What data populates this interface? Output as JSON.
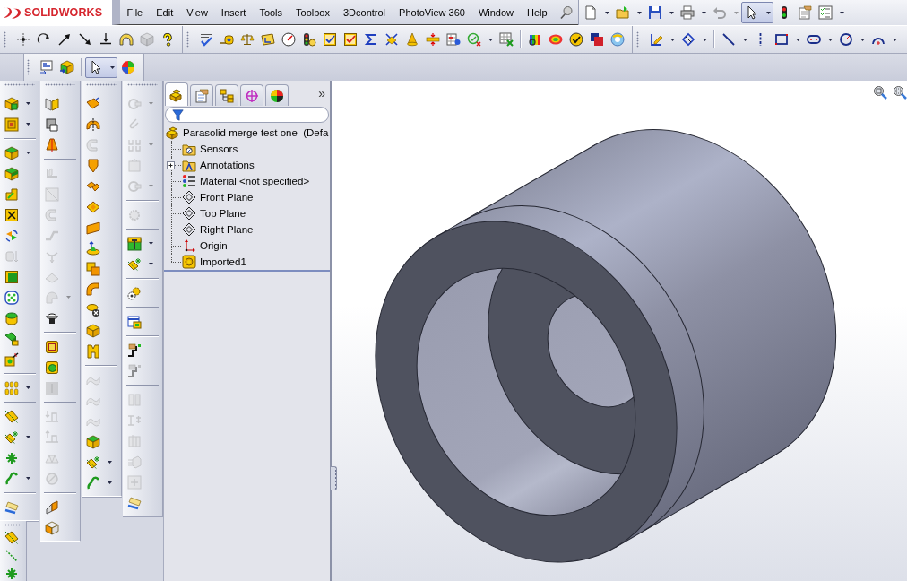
{
  "logo": {
    "text": "SOLIDWORKS"
  },
  "menu": [
    "File",
    "Edit",
    "View",
    "Insert",
    "Tools",
    "Toolbox",
    "3Dcontrol",
    "PhotoView 360",
    "Window",
    "Help"
  ],
  "standard_toolbar": {
    "buttons": [
      {
        "kind": "dropdown",
        "disabled": false,
        "pressed": false
      },
      {
        "kind": "dropdown",
        "disabled": false,
        "pressed": false
      },
      {
        "kind": "dropdown",
        "disabled": false,
        "pressed": false
      },
      {
        "kind": "dropdown",
        "disabled": false,
        "pressed": false
      },
      {
        "kind": "dropdown",
        "disabled": true,
        "pressed": false
      },
      {
        "kind": "dropdown",
        "disabled": false,
        "pressed": true
      },
      {
        "kind": "plain",
        "disabled": false,
        "pressed": false
      },
      {
        "kind": "plain",
        "disabled": false,
        "pressed": false
      },
      {
        "kind": "dropdown",
        "disabled": false,
        "pressed": false
      }
    ]
  },
  "toolbar_rows": [
    {
      "toolbars": [
        {
          "groups": [
            [
              {
                "kind": "plain",
                "disabled": false
              },
              {
                "kind": "plain",
                "disabled": false
              },
              {
                "kind": "plain",
                "disabled": false
              },
              {
                "kind": "plain",
                "disabled": false
              },
              {
                "kind": "plain",
                "disabled": false
              },
              {
                "kind": "plain",
                "disabled": false
              },
              {
                "kind": "plain",
                "disabled": true
              },
              {
                "kind": "plain",
                "disabled": false
              }
            ]
          ]
        },
        {
          "groups": [
            [
              {
                "kind": "plain",
                "disabled": false
              },
              {
                "kind": "plain",
                "disabled": false
              },
              {
                "kind": "plain",
                "disabled": false
              },
              {
                "kind": "plain",
                "disabled": false
              },
              {
                "kind": "plain",
                "disabled": false
              },
              {
                "kind": "plain",
                "disabled": false
              },
              {
                "kind": "plain",
                "disabled": false
              },
              {
                "kind": "plain",
                "disabled": false
              },
              {
                "kind": "plain",
                "disabled": false
              },
              {
                "kind": "plain",
                "disabled": false
              },
              {
                "kind": "plain",
                "disabled": false
              },
              {
                "kind": "plain",
                "disabled": false
              },
              {
                "kind": "plain",
                "disabled": false
              },
              {
                "kind": "dropdown",
                "disabled": false
              },
              {
                "kind": "plain",
                "disabled": false
              }
            ],
            [
              {
                "kind": "plain",
                "disabled": false
              },
              {
                "kind": "plain",
                "disabled": false
              },
              {
                "kind": "plain",
                "disabled": false
              },
              {
                "kind": "plain",
                "disabled": false
              },
              {
                "kind": "plain",
                "disabled": false
              }
            ]
          ]
        },
        {
          "groups": [
            [
              {
                "kind": "dropdown",
                "disabled": false
              },
              {
                "kind": "dropdown",
                "disabled": false
              }
            ],
            [
              {
                "kind": "dropdown",
                "disabled": false
              },
              {
                "kind": "plain",
                "disabled": false
              },
              {
                "kind": "dropdown",
                "disabled": false
              },
              {
                "kind": "dropdown",
                "disabled": false
              },
              {
                "kind": "dropdown",
                "disabled": false
              },
              {
                "kind": "dropdown",
                "disabled": false
              }
            ]
          ]
        }
      ]
    },
    {
      "toolbars": [
        {
          "groups": [
            [
              {
                "kind": "plain",
                "disabled": false,
                "pressed": false
              },
              {
                "kind": "plain",
                "disabled": false,
                "pressed": false
              }
            ],
            [
              {
                "kind": "dropdown",
                "disabled": false,
                "pressed": true
              },
              {
                "kind": "plain",
                "disabled": false,
                "pressed": false
              }
            ]
          ]
        }
      ]
    }
  ],
  "side_toolbars": [
    {
      "groups": [
        [
          {
            "kind": "dropdown",
            "disabled": false
          },
          {
            "kind": "dropdown",
            "disabled": false
          }
        ],
        [
          {
            "kind": "dropdown",
            "disabled": false
          },
          {
            "kind": "plain",
            "disabled": false
          },
          {
            "kind": "plain",
            "disabled": false
          },
          {
            "kind": "plain",
            "disabled": false
          },
          {
            "kind": "plain",
            "disabled": false
          },
          {
            "kind": "plain",
            "disabled": true
          },
          {
            "kind": "plain",
            "disabled": false
          },
          {
            "kind": "plain",
            "disabled": false
          },
          {
            "kind": "plain",
            "disabled": false
          },
          {
            "kind": "plain",
            "disabled": false
          },
          {
            "kind": "plain",
            "disabled": false
          }
        ],
        [
          {
            "kind": "dropdown",
            "disabled": false
          }
        ],
        [
          {
            "kind": "plain",
            "disabled": false
          },
          {
            "kind": "dropdown",
            "disabled": false
          },
          {
            "kind": "plain",
            "disabled": false
          },
          {
            "kind": "dropdown",
            "disabled": false
          }
        ],
        [
          {
            "kind": "plain",
            "disabled": false
          }
        ]
      ]
    },
    {
      "groups": [
        [
          {
            "kind": "plain",
            "disabled": false
          },
          {
            "kind": "plain",
            "disabled": false
          },
          {
            "kind": "plain",
            "disabled": false
          }
        ],
        [
          {
            "kind": "plain",
            "disabled": true
          },
          {
            "kind": "plain",
            "disabled": true
          },
          {
            "kind": "plain",
            "disabled": true
          },
          {
            "kind": "plain",
            "disabled": true
          },
          {
            "kind": "plain",
            "disabled": true
          },
          {
            "kind": "plain",
            "disabled": true
          },
          {
            "kind": "dropdown",
            "disabled": true
          },
          {
            "kind": "plain",
            "disabled": false
          }
        ],
        [
          {
            "kind": "plain",
            "disabled": false
          },
          {
            "kind": "plain",
            "disabled": false
          },
          {
            "kind": "plain",
            "disabled": true
          }
        ],
        [
          {
            "kind": "plain",
            "disabled": true
          },
          {
            "kind": "plain",
            "disabled": true
          },
          {
            "kind": "plain",
            "disabled": true
          },
          {
            "kind": "plain",
            "disabled": true
          }
        ],
        [
          {
            "kind": "plain",
            "disabled": false
          },
          {
            "kind": "plain",
            "disabled": false
          }
        ]
      ]
    },
    {
      "groups": [
        [
          {
            "kind": "plain",
            "disabled": false
          },
          {
            "kind": "plain",
            "disabled": false
          },
          {
            "kind": "plain",
            "disabled": true
          },
          {
            "kind": "plain",
            "disabled": false
          },
          {
            "kind": "plain",
            "disabled": false
          },
          {
            "kind": "plain",
            "disabled": false
          },
          {
            "kind": "plain",
            "disabled": false
          },
          {
            "kind": "plain",
            "disabled": false
          },
          {
            "kind": "plain",
            "disabled": false
          },
          {
            "kind": "plain",
            "disabled": false
          },
          {
            "kind": "plain",
            "disabled": false
          },
          {
            "kind": "plain",
            "disabled": false
          },
          {
            "kind": "plain",
            "disabled": false
          }
        ],
        [
          {
            "kind": "plain",
            "disabled": true
          },
          {
            "kind": "plain",
            "disabled": true
          },
          {
            "kind": "plain",
            "disabled": true
          },
          {
            "kind": "plain",
            "disabled": false
          },
          {
            "kind": "dropdown",
            "disabled": false
          },
          {
            "kind": "dropdown",
            "disabled": false
          }
        ]
      ]
    },
    {
      "groups": [
        [
          {
            "kind": "dropdown",
            "disabled": true
          },
          {
            "kind": "plain",
            "disabled": true
          },
          {
            "kind": "dropdown",
            "disabled": true
          },
          {
            "kind": "plain",
            "disabled": true
          },
          {
            "kind": "dropdown",
            "disabled": true
          }
        ],
        [
          {
            "kind": "plain",
            "disabled": true
          }
        ],
        [
          {
            "kind": "dropdown",
            "disabled": false
          },
          {
            "kind": "dropdown",
            "disabled": false
          }
        ],
        [
          {
            "kind": "plain",
            "disabled": false
          }
        ],
        [
          {
            "kind": "plain",
            "disabled": false
          }
        ],
        [
          {
            "kind": "plain",
            "disabled": false
          },
          {
            "kind": "plain",
            "disabled": true
          }
        ],
        [
          {
            "kind": "plain",
            "disabled": true
          },
          {
            "kind": "plain",
            "disabled": true
          },
          {
            "kind": "plain",
            "disabled": true
          },
          {
            "kind": "plain",
            "disabled": true
          },
          {
            "kind": "plain",
            "disabled": true
          },
          {
            "kind": "plain",
            "disabled": false
          }
        ]
      ]
    },
    {
      "groups": [
        [
          {
            "kind": "plain",
            "disabled": false
          },
          {
            "kind": "plain",
            "disabled": false
          },
          {
            "kind": "plain",
            "disabled": false
          }
        ]
      ]
    }
  ],
  "feature_manager": {
    "tabs": [
      {
        "selected": true
      },
      {
        "selected": false
      },
      {
        "selected": false
      },
      {
        "selected": false
      },
      {
        "selected": false
      }
    ],
    "more": "»",
    "tree": {
      "kind": "part",
      "label": "Parasolid merge test one  (Defa",
      "children": [
        {
          "kind": "sensor_folder",
          "label": "Sensors"
        },
        {
          "kind": "annotation_folder",
          "label": "Annotations",
          "expanded": false
        },
        {
          "kind": "material",
          "label": "Material <not specified>"
        },
        {
          "kind": "plane",
          "label": "Front Plane"
        },
        {
          "kind": "plane",
          "label": "Top Plane"
        },
        {
          "kind": "plane",
          "label": "Right Plane"
        },
        {
          "kind": "origin",
          "label": "Origin"
        },
        {
          "kind": "imported_body",
          "label": "Imported1"
        }
      ]
    }
  }
}
